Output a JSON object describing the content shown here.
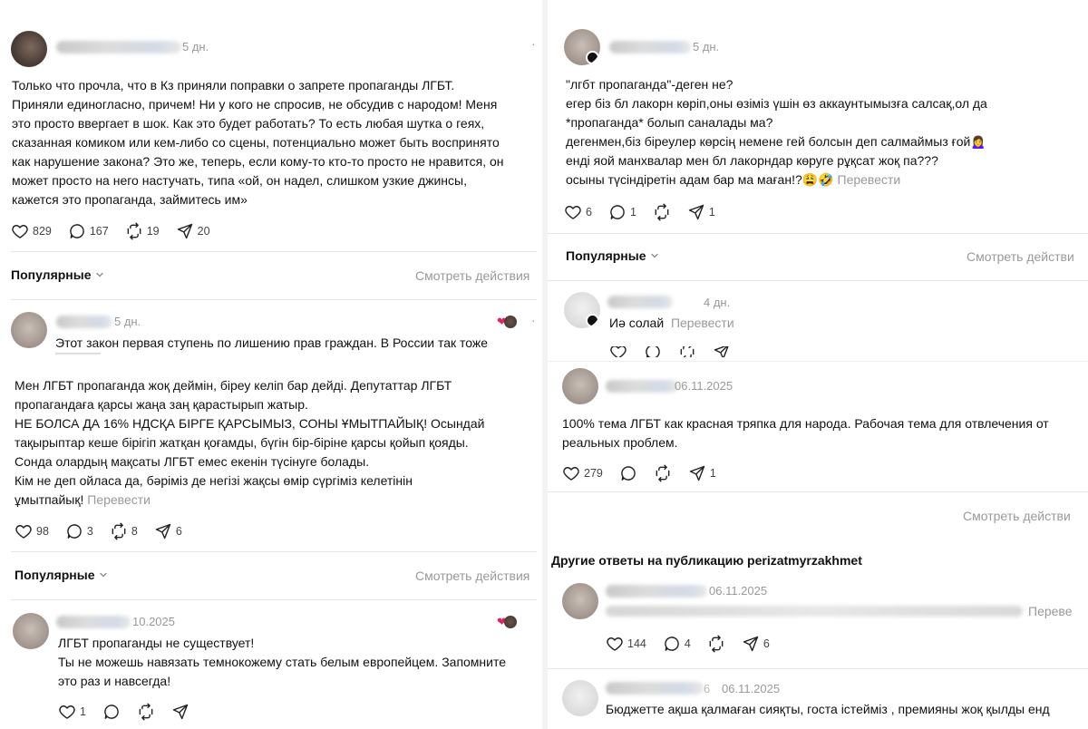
{
  "left": {
    "post1": {
      "time": "5 дн.",
      "text": "Только что прочла, что в Кз приняли поправки о запрете пропаганды ЛГБТ.\nПриняли единогласно, причем! Ни у кого не спросив, не обсудив с народом! Меня\nэто просто ввергает в шок. Как это будет работать? То есть любая шутка о геях,\nсказанная комиком или кем-либо со сцены, потенциально может быть воспринято\nкак нарушение закона? Это же, теперь, если кому-то кто-то просто не нравится, он\nможет просто на него настучать, типа «ой, он надел, слишком узкие джинсы,\nкажется это пропаганда, займитесь им»",
      "likes": "829",
      "comments": "167",
      "reposts": "19",
      "shares": "20"
    },
    "sort1": {
      "label": "Популярные",
      "view": "Смотреть действия"
    },
    "reply1": {
      "time": "5 дн.",
      "text": "Этот закон первая ступень по лишению прав граждан. В России так тоже"
    },
    "post2": {
      "text": "Мен ЛГБТ пропаганда жоқ деймін, біреу келіп бар дейді. Депутаттар ЛГБТ\nпропагандаға қарсы жаңа заң қарастырып жатыр.\nНЕ БОЛСА ДА 16% НДСҚА БІРГЕ ҚАРСЫМЫЗ, СОНЫ ҰМЫТПАЙЫҚ! Осындай\nтақырыптар кеше бірігіп жатқан қоғамды, бүгін бір-біріне қарсы қойып қояды.\nСонда олардың мақсаты ЛГБТ емес екенін түсінуге болады.\nКім не деп ойласа да, бәріміз де негізі жақсы өмір сүргіміз келетінін",
      "last_line": "ұмытпайық!",
      "translate": "Перевести",
      "likes": "98",
      "comments": "3",
      "reposts": "8",
      "shares": "6"
    },
    "sort2": {
      "label": "Популярные",
      "view": "Смотреть действия"
    },
    "reply2": {
      "time": "10.2025",
      "text": "ЛГБТ пропаганды не существует!\nТы не можешь навязать темнокожему стать белым европейцем. Запомните\nэто раз и навсегда!",
      "likes": "1"
    }
  },
  "right": {
    "post1": {
      "time": "5 дн.",
      "text": "\"лгбт пропаганда\"-деген не?\nегер біз бл лакорн көріп,оны өзіміз үшін өз аккаунтымызға салсақ,ол да\n*пропаганда* болып саналады ма?\nдегенмен,біз біреулер көрсің немене гей болсын деп салмаймыз ғой🙍‍♀️\nенді яой манхвалар мен бл лакорндар көруге рұқсат жоқ па???",
      "last_line": "осыны түсіндіретін адам бар ма маған!?😩🤣",
      "translate": "Перевести",
      "likes": "6",
      "comments": "1",
      "shares": "1"
    },
    "sort1": {
      "label": "Популярные",
      "view": "Смотреть действи"
    },
    "reply1": {
      "time": "4 дн.",
      "text": "Иә солай",
      "translate": "Перевести"
    },
    "reply2": {
      "time": "06.11.2025",
      "text": "100% тема ЛГБТ как красная тряпка для народа. Рабочая тема для отвлечения от\nреальных проблем.",
      "likes": "279",
      "shares": "1"
    },
    "view2": "Смотреть действи",
    "other_title": "Другие ответы на публикацию perizatmyrzakhmet",
    "other1": {
      "time": "06.11.2025",
      "translate": "Переве",
      "likes": "144",
      "comments": "4",
      "shares": "6"
    },
    "other2": {
      "user_partial": "6",
      "time": "06.11.2025",
      "text": "Бюджетте ақша қалмаған сияқты, госта істейміз , премияны жоқ қылды енд"
    }
  }
}
